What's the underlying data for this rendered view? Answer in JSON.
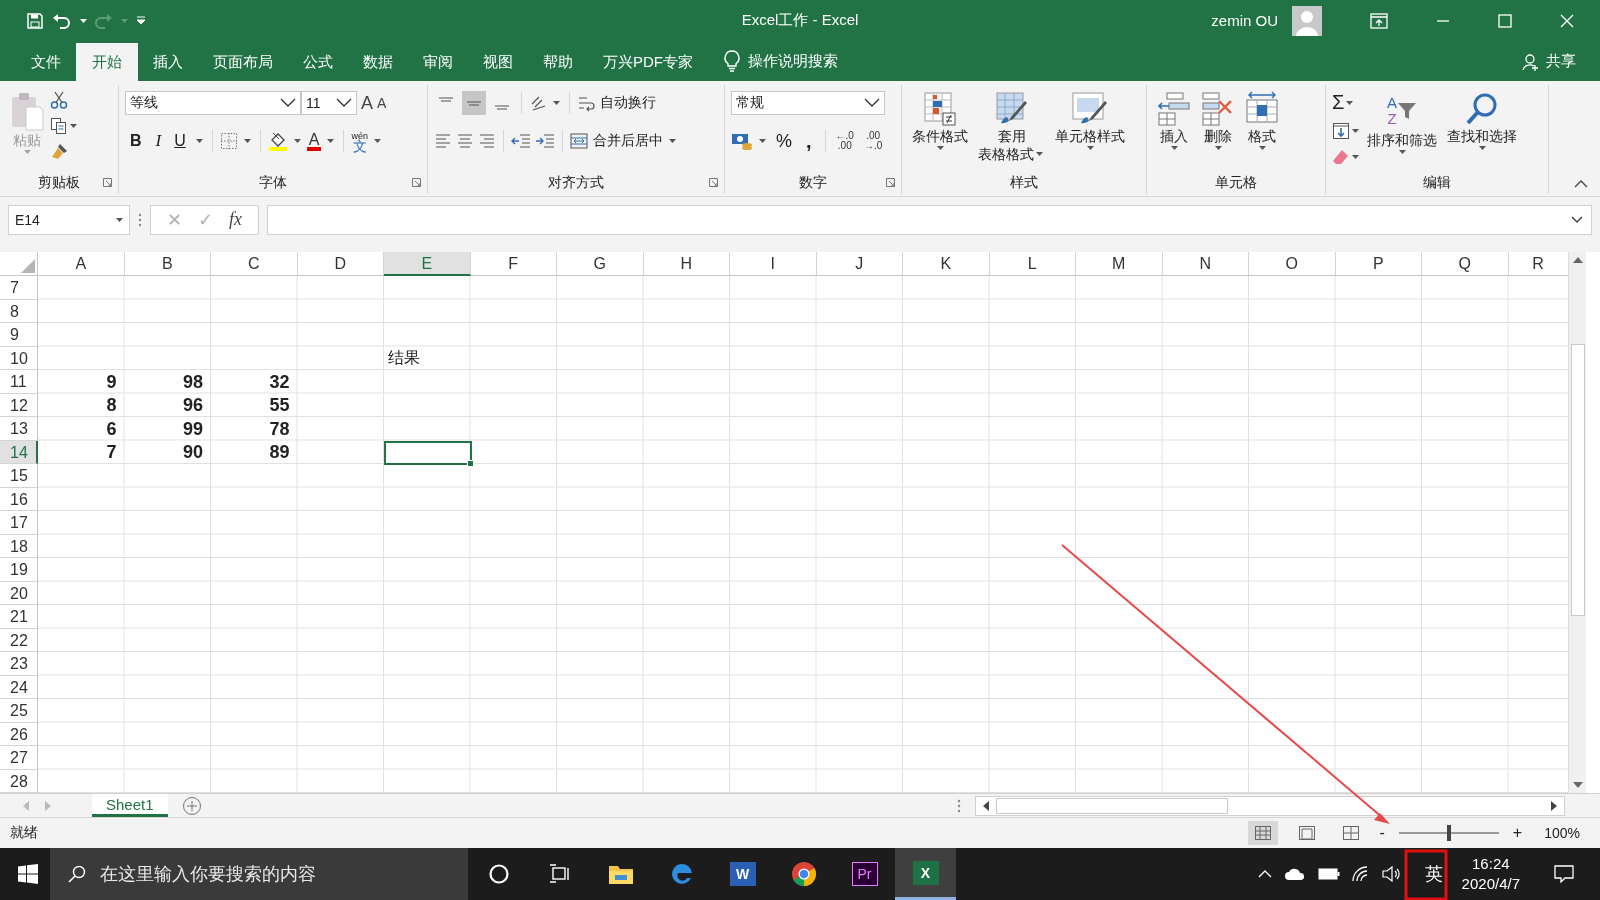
{
  "title_bar": {
    "title": "Excel工作  -  Excel",
    "user": "zemin OU"
  },
  "tabs": [
    {
      "label": "文件",
      "selected": false
    },
    {
      "label": "开始",
      "selected": true
    },
    {
      "label": "插入",
      "selected": false
    },
    {
      "label": "页面布局",
      "selected": false
    },
    {
      "label": "公式",
      "selected": false
    },
    {
      "label": "数据",
      "selected": false
    },
    {
      "label": "审阅",
      "selected": false
    },
    {
      "label": "视图",
      "selected": false
    },
    {
      "label": "帮助",
      "selected": false
    },
    {
      "label": "万兴PDF专家",
      "selected": false
    }
  ],
  "tell_me": "操作说明搜索",
  "share": "共享",
  "clipboard": {
    "paste": "粘贴",
    "label": "剪贴板"
  },
  "font": {
    "name": "等线",
    "size": "11",
    "grow": "A",
    "shrink": "A",
    "bold": "B",
    "italic": "I",
    "underline": "U",
    "color_letter": "A",
    "phonetic": [
      "wén",
      "文"
    ],
    "label": "字体"
  },
  "alignment": {
    "vertical": [
      {
        "selected": false
      },
      {
        "selected": true
      },
      {
        "selected": false
      }
    ],
    "wrap": "自动换行",
    "merge": "合并后居中",
    "label": "对齐方式"
  },
  "number": {
    "format": "常规",
    "percent": "%",
    "comma": ",",
    "increase_decimal": [
      "←.0",
      ".00"
    ],
    "decrease_decimal": [
      ".00",
      "→.0"
    ],
    "label": "数字"
  },
  "styles": {
    "conditional": "条件格式",
    "table": [
      "套用",
      "表格格式"
    ],
    "cell": "单元格样式",
    "label": "样式"
  },
  "cells": {
    "insert": "插入",
    "delete": "删除",
    "format": "格式",
    "label": "单元格"
  },
  "editing": {
    "sum": "Σ",
    "sort_letters": [
      "A",
      "Z"
    ],
    "sort": "排序和筛选",
    "find": "查找和选择",
    "label": "编辑"
  },
  "formula_bar": {
    "name_box": "E14",
    "cancel": "✕",
    "enter": "✓",
    "fx": "fx"
  },
  "columns": [
    {
      "label": "A",
      "selected": false
    },
    {
      "label": "B",
      "selected": false
    },
    {
      "label": "C",
      "selected": false
    },
    {
      "label": "D",
      "selected": false
    },
    {
      "label": "E",
      "selected": true
    },
    {
      "label": "F",
      "selected": false
    },
    {
      "label": "G",
      "selected": false
    },
    {
      "label": "H",
      "selected": false
    },
    {
      "label": "I",
      "selected": false
    },
    {
      "label": "J",
      "selected": false
    },
    {
      "label": "K",
      "selected": false
    },
    {
      "label": "L",
      "selected": false
    },
    {
      "label": "M",
      "selected": false
    },
    {
      "label": "N",
      "selected": false
    },
    {
      "label": "O",
      "selected": false
    },
    {
      "label": "P",
      "selected": false
    },
    {
      "label": "Q",
      "selected": false
    },
    {
      "label": "R",
      "selected": false
    }
  ],
  "rows": [
    {
      "number": "7",
      "selected": false
    },
    {
      "number": "8",
      "selected": false
    },
    {
      "number": "9",
      "selected": false
    },
    {
      "number": "10",
      "selected": false,
      "label": "结果"
    },
    {
      "number": "11",
      "selected": false,
      "values": [
        "9",
        "98",
        "32"
      ]
    },
    {
      "number": "12",
      "selected": false,
      "values": [
        "8",
        "96",
        "55"
      ]
    },
    {
      "number": "13",
      "selected": false,
      "values": [
        "6",
        "99",
        "78"
      ]
    },
    {
      "number": "14",
      "selected": true,
      "values": [
        "7",
        "90",
        "89"
      ]
    },
    {
      "number": "15",
      "selected": false
    },
    {
      "number": "16",
      "selected": false
    },
    {
      "number": "17",
      "selected": false
    },
    {
      "number": "18",
      "selected": false
    },
    {
      "number": "19",
      "selected": false
    },
    {
      "number": "20",
      "selected": false
    },
    {
      "number": "21",
      "selected": false
    },
    {
      "number": "22",
      "selected": false
    },
    {
      "number": "23",
      "selected": false
    },
    {
      "number": "24",
      "selected": false
    },
    {
      "number": "25",
      "selected": false
    },
    {
      "number": "26",
      "selected": false
    },
    {
      "number": "27",
      "selected": false
    },
    {
      "number": "28",
      "selected": false
    }
  ],
  "sheets": [
    {
      "label": "Sheet1",
      "selected": true
    }
  ],
  "status_bar": {
    "status": "就绪",
    "views": [
      {
        "selected": true
      },
      {
        "selected": false
      },
      {
        "selected": false
      }
    ],
    "zoom_out": "-",
    "zoom_in": "+",
    "zoom": {
      "level": 0.5
    },
    "zoom_text": "100%"
  },
  "taskbar": {
    "search_placeholder": "在这里输入你要搜索的内容",
    "apps": [
      {
        "kind": "cortana",
        "selected": false
      },
      {
        "kind": "taskview",
        "selected": false
      },
      {
        "kind": "folder",
        "selected": false
      },
      {
        "kind": "edge",
        "selected": false
      },
      {
        "kind": "word",
        "letter": "W",
        "selected": false
      },
      {
        "kind": "chrome",
        "selected": false
      },
      {
        "kind": "premiere",
        "letter": "Pr",
        "selected": false
      },
      {
        "kind": "excel",
        "letter": "X",
        "selected": true
      }
    ],
    "ime": "英",
    "time": "16:24",
    "date": "2020/4/7"
  }
}
